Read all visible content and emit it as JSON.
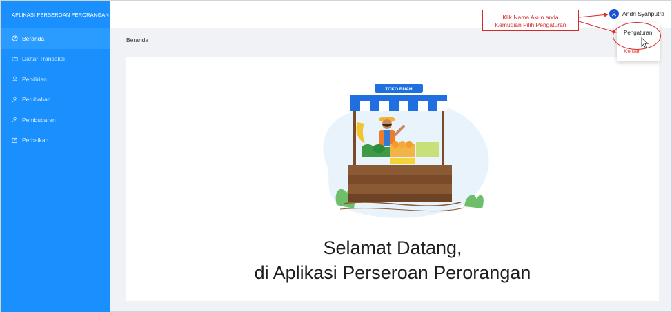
{
  "sidebar": {
    "app_title": "APLIKASI PERSEROAN PERORANGAN",
    "items": [
      {
        "label": "Beranda",
        "icon": "dashboard-icon",
        "active": true
      },
      {
        "label": "Daftar Transaksi",
        "icon": "folder-open-icon",
        "active": false
      },
      {
        "label": "Pendirian",
        "icon": "user-icon",
        "active": false
      },
      {
        "label": "Perubahan",
        "icon": "user-icon",
        "active": false
      },
      {
        "label": "Pembubaran",
        "icon": "user-icon",
        "active": false
      },
      {
        "label": "Perbaikan",
        "icon": "edit-icon",
        "active": false
      }
    ]
  },
  "header": {
    "user_name": "Andri Syahputra",
    "avatar_icon": "user-avatar-icon"
  },
  "dropdown": {
    "items": [
      "Pengaturan",
      "Keluar"
    ]
  },
  "annotation": {
    "line1": "Klik Nama Akun anda",
    "line2": "Kemudian Pilih Pengaturan"
  },
  "breadcrumb": "Beranda",
  "illustration": {
    "sign_text": "TOKO BUAH"
  },
  "welcome": {
    "line1": "Selamat Datang,",
    "line2": "di Aplikasi Perseroan Perorangan"
  },
  "colors": {
    "sidebar": "#1a90ff",
    "content_bg": "#f0f2f5",
    "annotation": "#d62a2a",
    "logout": "#e64b3c",
    "awning_blue": "#1f6fe0"
  }
}
